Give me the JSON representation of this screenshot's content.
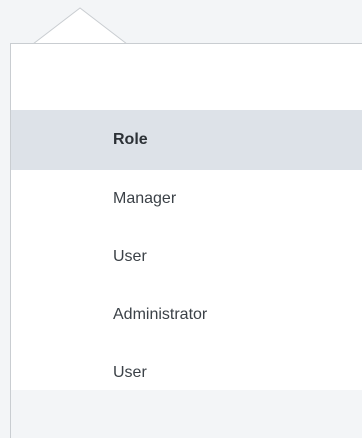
{
  "dropdown": {
    "header": "Role",
    "options": [
      {
        "label": "Manager"
      },
      {
        "label": "User"
      },
      {
        "label": "Administrator"
      },
      {
        "label": "User"
      }
    ]
  },
  "colors": {
    "background": "#f3f5f7",
    "panel": "#ffffff",
    "header_bg": "#dde2e8",
    "border": "#c9cdd1",
    "text": "#3b4147"
  }
}
